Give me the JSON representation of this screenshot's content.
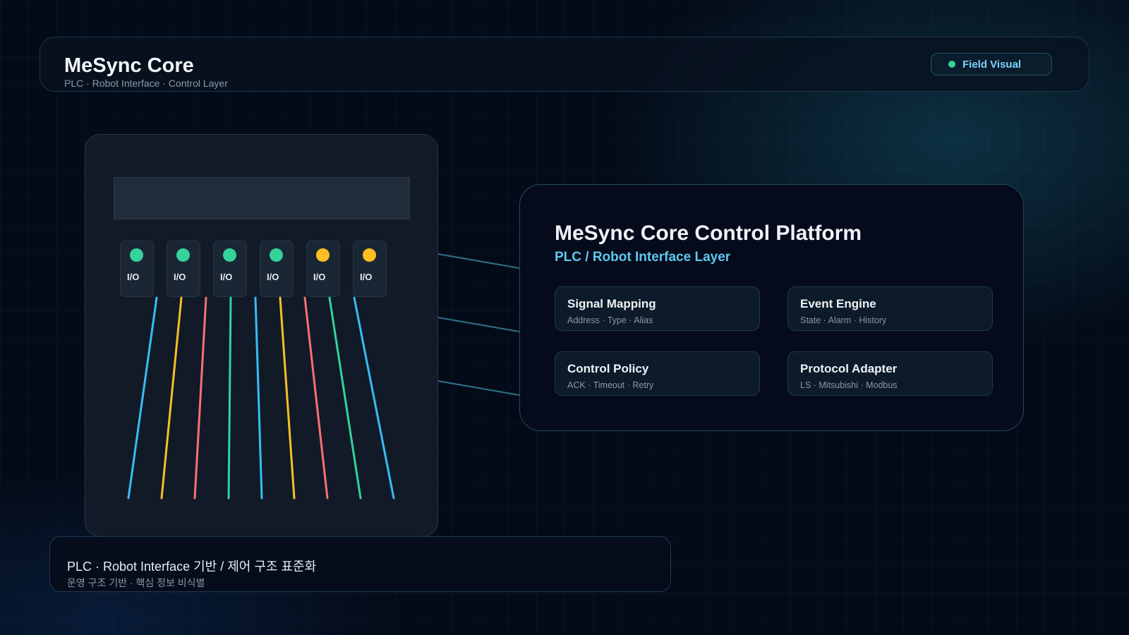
{
  "header": {
    "title": "MeSync Core",
    "subtitle": "PLC · Robot Interface · Control Layer",
    "badge_label": "Field Visual"
  },
  "plc_panel": {
    "io_modules": [
      {
        "label": "I/O",
        "status_color": "#34d399"
      },
      {
        "label": "I/O",
        "status_color": "#34d399"
      },
      {
        "label": "I/O",
        "status_color": "#34d399"
      },
      {
        "label": "I/O",
        "status_color": "#34d399"
      },
      {
        "label": "I/O",
        "status_color": "#fbbf24"
      },
      {
        "label": "I/O",
        "status_color": "#fbbf24"
      }
    ],
    "wire_colors": [
      "#38bdf8",
      "#fbbf24",
      "#f87171",
      "#34d399",
      "#38bdf8",
      "#fbbf24",
      "#f87171",
      "#34d399",
      "#38bdf8"
    ]
  },
  "platform": {
    "title": "MeSync Core Control Platform",
    "subtitle": "PLC / Robot Interface Layer",
    "cards": [
      {
        "title": "Signal Mapping",
        "desc": "Address · Type · Alias"
      },
      {
        "title": "Event Engine",
        "desc": "State · Alarm · History"
      },
      {
        "title": "Control Policy",
        "desc": "ACK · Timeout · Retry"
      },
      {
        "title": "Protocol Adapter",
        "desc": "LS · Mitsubishi · Modbus"
      }
    ]
  },
  "footer": {
    "title": "PLC · Robot Interface 기반  /  제어 구조 표준화",
    "subtitle": "운영 구조 기반 · 핵심 정보 비식별"
  },
  "colors": {
    "background": "#040b18",
    "accent_cyan": "#5ec8ef",
    "status_green": "#34d399",
    "status_amber": "#fbbf24",
    "wire_red": "#f87171",
    "connector": "#2f6f8a"
  }
}
